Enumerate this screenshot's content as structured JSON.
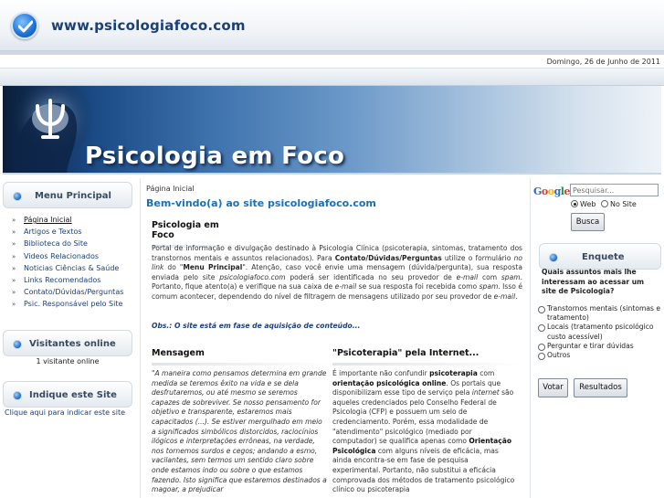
{
  "header": {
    "site_url": "www.psicologiafoco.com",
    "date": "Domingo, 26 de Junho de 2011"
  },
  "banner": {
    "title": "Psicologia em Foco"
  },
  "left": {
    "menu_title": "Menu Principal",
    "menu_items": [
      "Página Inicial",
      "Artigos e Textos",
      "Biblioteca do Site",
      "Videos Relacionados",
      "Noticias Ciências & Saúde",
      "Links Recomendados",
      "Contato/Dúvidas/Perguntas",
      "Psic. Responsável pelo Site"
    ],
    "visitors_title": "Visitantes online",
    "visitors_text": "1 visitante online",
    "indicate_title": "Indique este Site",
    "indicate_link": "Clique aqui para indicar este site"
  },
  "main": {
    "breadcrumb": "Página Inicial",
    "welcome": "Bem-vindo(a) ao site psicologiafoco.com",
    "psico_heading": "Psicologia em Foco",
    "intro": {
      "p1": "Portal de informação e divulgação destinado à Psicologia Clínica (psicoterapia, sintomas, tratamento dos transtornos mentais e assuntos relacionados). Para ",
      "contact": "Contato/Dúvidas/Perguntas",
      "p2": " utilize o formulário ",
      "p3": "no link",
      "p4": " do \"",
      "menu": "Menu Principal",
      "p5": "\". Atenção, caso você envie uma mensagem (dúvida/pergunta), sua resposta enviada pelo site ",
      "p6": "psicologiafoco.com",
      "p7": " poderá ser identificada no seu provedor de ",
      "p8": "e-mail",
      "p9": " com ",
      "p10": "spam",
      "p11": ". Portanto, fique atento(a) e verifique na sua caixa de ",
      "p12": "e-mail",
      "p13": " se sua resposta foi recebida como ",
      "p14": "spam",
      "p15": ". Isso é comum acontecer, dependendo do nível de filtragem de mensagens utilizado por seu provedor de ",
      "p16": "e-mail",
      "p17": "."
    },
    "obs": "Obs.: O site está em fase de aquisição de conteúdo...",
    "message_heading": "Mensagem",
    "message_quote": "\"A maneira como pensamos determina em grande medida se teremos êxito na vida e se dela desfrutaremos, ou até mesmo se seremos capazes de sobreviver. Se nosso pensamento for objetivo e transparente, estaremos mais capacitados (...). Se estiver mergulhado em meio a significados simbólicos distorcidos, raciocínios ilógicos e interpretações errôneas, na verdade, nos tornemos surdos e cegos; andando a esmo, vacilantes, sem termos um sentido claro sobre onde estamos indo ou sobre o que estamos fazendo. Isto significa que estaremos destinados a magoar, a prejudicar",
    "internet_heading": "\"Psicoterapia\" pela Internet...",
    "internet": {
      "t1": "É importante não confundir ",
      "t2": "psicoterapia",
      "t3": " com ",
      "t4": "orientação psicológica online",
      "t5": ". Os portais que disponibilizam esse tipo de serviço pela ",
      "t6": "internet",
      "t7": " são aqueles credenciados pelo Conselho Federal de Psicologia (CFP) e possuem um selo de credenciamento. Porém, essa modalidade de \"atendimento\" psicológico (mediado por computador) se qualifica apenas como ",
      "t8": "Orientação Psicológica",
      "t9": " com alguns níveis de eficácia, mas ainda encontra-se em fase de pesquisa experimental. Portanto, não substitui a eficácia comprovada dos métodos de tratamento psicológico clínico ou psicoterapia"
    }
  },
  "right": {
    "google_letters": [
      "G",
      "o",
      "o",
      "g",
      "l",
      "e"
    ],
    "google_colors": [
      "#3366cc",
      "#dd3b2e",
      "#f3b400",
      "#3366cc",
      "#109e4a",
      "#dd3b2e"
    ],
    "search_placeholder": "Pesquisar...",
    "radio_web": "Web",
    "radio_site": "No Site",
    "search_button": "Busca",
    "poll_title": "Enquete",
    "poll_question": "Quais assuntos mais lhe interessam ao acessar um site de Psicologia?",
    "poll_options": [
      "Transtornos mentais (sintomas e tratamento)",
      "Locais (tratamento psicológico custo acessível)",
      "Perguntar e tirar dúvidas",
      "Outros"
    ],
    "vote_button": "Votar",
    "results_button": "Resultados"
  },
  "colors": {
    "link_blue": "#1c3f78",
    "heading_blue": "#1a6fb5"
  }
}
